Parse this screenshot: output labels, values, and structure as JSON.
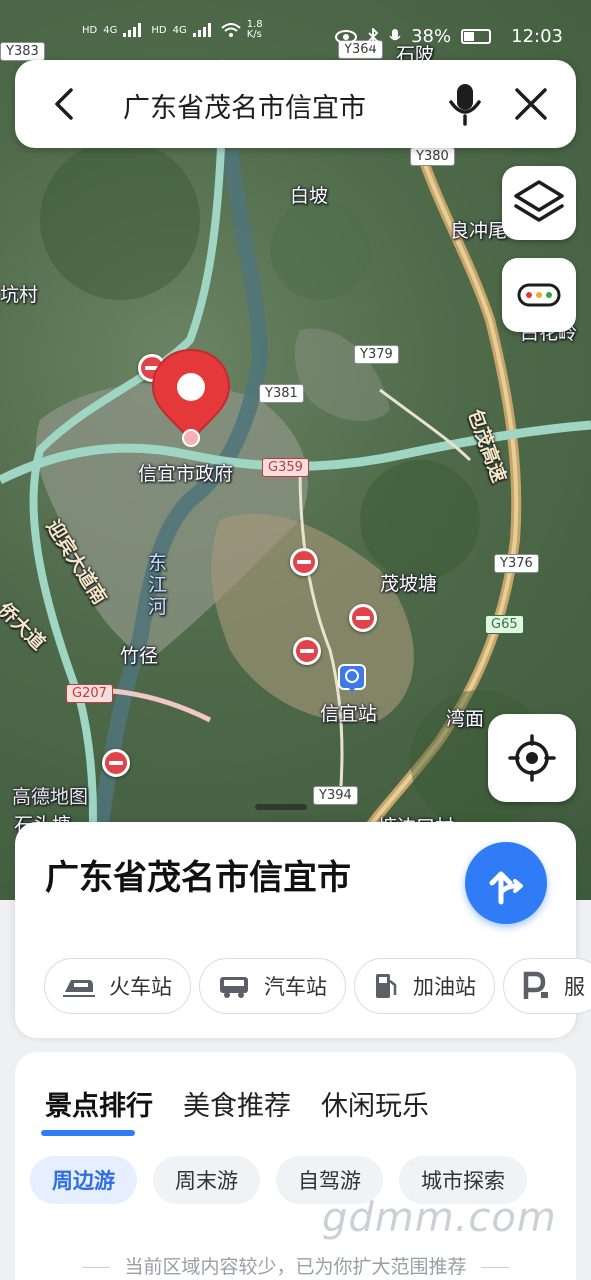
{
  "status_bar": {
    "left_labels": [
      "HD",
      "4G",
      "HD",
      "4G"
    ],
    "speed": "1.8 K/s",
    "battery": "38%",
    "time": "12:03"
  },
  "search": {
    "query": "广东省茂名市信宜市"
  },
  "map": {
    "labels": {
      "baipo": "白坡",
      "liangchong": "良冲尾",
      "kengcun": "坑村",
      "baihualing": "白花岭",
      "govt": "信宜市政府",
      "dongjiang": "东江河",
      "maopotang": "茂坡塘",
      "zhujing": "竹径",
      "xinyi_station": "信宜站",
      "wanmian": "湾面",
      "gaode": "高德地图",
      "shitou": "石头塘",
      "boyou": "塘边口村",
      "shiling": "石陂",
      "yingbin": "迎宾大道南",
      "qiaohua": "侨大道",
      "baomao": "包茂高速"
    },
    "shields": {
      "y383": "Y383",
      "y364": "Y364",
      "y380": "Y380",
      "y379": "Y379",
      "y381": "Y381",
      "g359": "G359",
      "y376": "Y376",
      "g65": "G65",
      "g207": "G207",
      "y394": "Y394"
    }
  },
  "place": {
    "title": "广东省茂名市信宜市",
    "chips": [
      "火车站",
      "汽车站",
      "加油站",
      "服"
    ]
  },
  "discover": {
    "tabs": [
      "景点排行",
      "美食推荐",
      "休闲玩乐"
    ],
    "pills": [
      "周边游",
      "周末游",
      "自驾游",
      "城市探索"
    ]
  },
  "hint": "当前区域内容较少，已为你扩大范围推荐",
  "watermark": "gdmm.com"
}
